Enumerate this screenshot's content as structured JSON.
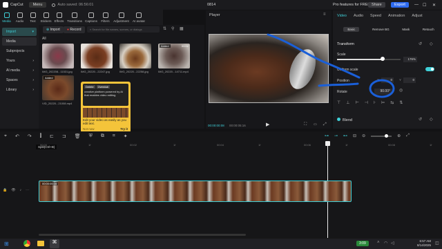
{
  "titlebar": {
    "app_name": "CapCut",
    "menu_label": "Menu",
    "autosave": "Auto saved: 06:56:01",
    "project_title": "0814",
    "pro_label": "Pro features for FREE",
    "share_label": "Share",
    "export_label": "Export"
  },
  "top_tabs": [
    "Media",
    "Audio",
    "Text",
    "Stickers",
    "Effects",
    "Transitions",
    "Captions",
    "Filters",
    "Adjustment",
    "AI avatar"
  ],
  "left_nav": [
    "Import",
    "Media",
    "Subprojects",
    "Yours",
    "AI media",
    "Spaces",
    "Library"
  ],
  "media_panel": {
    "import_label": "Import",
    "record_label": "Record",
    "search_placeholder": "Search for file names, scenes, or dialogs",
    "all_label": "All",
    "items": [
      {
        "name": "IMG_202208...11531.jpg",
        "badge": ""
      },
      {
        "name": "IMG_20220...22247.jpg",
        "badge": ""
      },
      {
        "name": "IMG_20220...22258.jpg",
        "badge": ""
      },
      {
        "name": "IMG_20220...14711.mp4",
        "badge": "Added",
        "duration": "00:02"
      },
      {
        "name": "VID_20220...21008.mp4",
        "badge": "Added",
        "duration": ""
      }
    ]
  },
  "tooltip": {
    "delete_label": "Delete",
    "overdub_label": "Overdub",
    "text1": "creative platform powered by AI that enables video editing",
    "text2": "Edit your video as easily as you edit text.",
    "not_now": "Not now",
    "try_it": "Try it"
  },
  "player": {
    "title": "Player",
    "time_current": "00:00:00:08",
    "time_total": "00:00:05:16"
  },
  "props": {
    "tabs": [
      "Video",
      "Audio",
      "Speed",
      "Animation",
      "Adjust"
    ],
    "subtabs": [
      "Basic",
      "Remove BG",
      "Mask",
      "Retouch"
    ],
    "transform_label": "Transform",
    "scale_label": "Scale",
    "scale_value": "176%",
    "scale_fraction": 0.72,
    "uniform_label": "Uniform scale",
    "position_label": "Position",
    "pos_x_label": "X",
    "pos_x": "0",
    "pos_y_label": "Y",
    "pos_y": "0",
    "rotate_label": "Rotate",
    "rotate_value": "90.00°",
    "blend_label": "Blend"
  },
  "timeline": {
    "split_tooltip": "Split(Ctrl+B)",
    "ticks": [
      "00:00",
      "1f",
      "00:02",
      "1f",
      "00:04",
      "1f",
      "00:06",
      "1f",
      "00:08",
      "1f"
    ],
    "clip_duration": "00:00:05:16"
  },
  "taskbar": {
    "weather": "3:09",
    "time": "6:57 AM",
    "date": "8/14/2025"
  },
  "colors": {
    "accent": "#3fd0d8",
    "tooltip_yellow": "#f4c43a",
    "annotation_blue": "#1a5fd8",
    "export_blue": "#2e6bf0"
  }
}
